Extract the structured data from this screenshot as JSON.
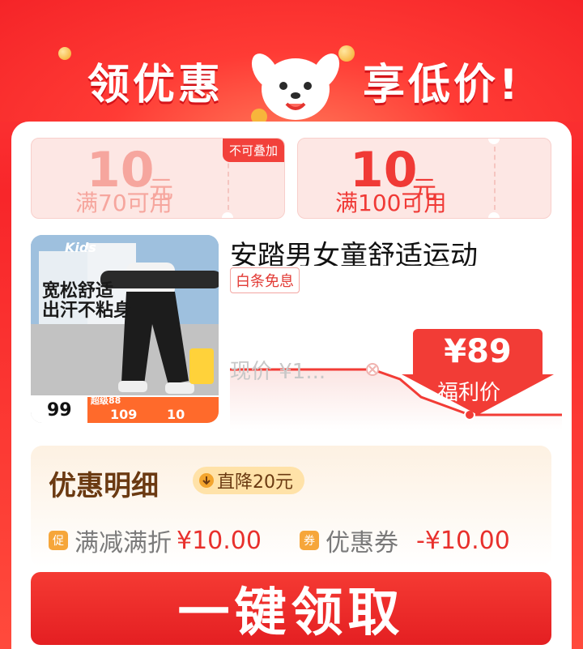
{
  "header": {
    "left_title": "领优惠",
    "right_title": "享低价!"
  },
  "coupons": [
    {
      "amount": "10",
      "unit": "元",
      "condition": "满70可用",
      "tag": "不可叠加"
    },
    {
      "amount": "10",
      "unit": "元",
      "condition": "满100可用"
    }
  ],
  "product": {
    "title": "安踏男女童舒适运动",
    "installment_tag": "白条免息",
    "current_price_label": "现价 ¥1...",
    "deal_price": "¥89",
    "deal_label": "福利价"
  },
  "image_overlay": {
    "brand": "Kids",
    "headline_1": "宽松舒适",
    "headline_2": "出汗不粘身",
    "price_tag": "99",
    "banner_price_1": "109",
    "banner_price_2": "10",
    "promo": "超级88"
  },
  "detail": {
    "title": "优惠明细",
    "badge": "直降20元",
    "rows": [
      {
        "icon_text": "促",
        "label": "满减满折",
        "value": "¥10.00"
      },
      {
        "icon_text": "券",
        "label": "优惠券",
        "value": "-¥10.00"
      }
    ]
  },
  "cta": {
    "label": "一键领取"
  },
  "colors": {
    "accent": "#f23c36",
    "brown": "#6b3a12",
    "coupon_bg": "#fde7e4"
  }
}
